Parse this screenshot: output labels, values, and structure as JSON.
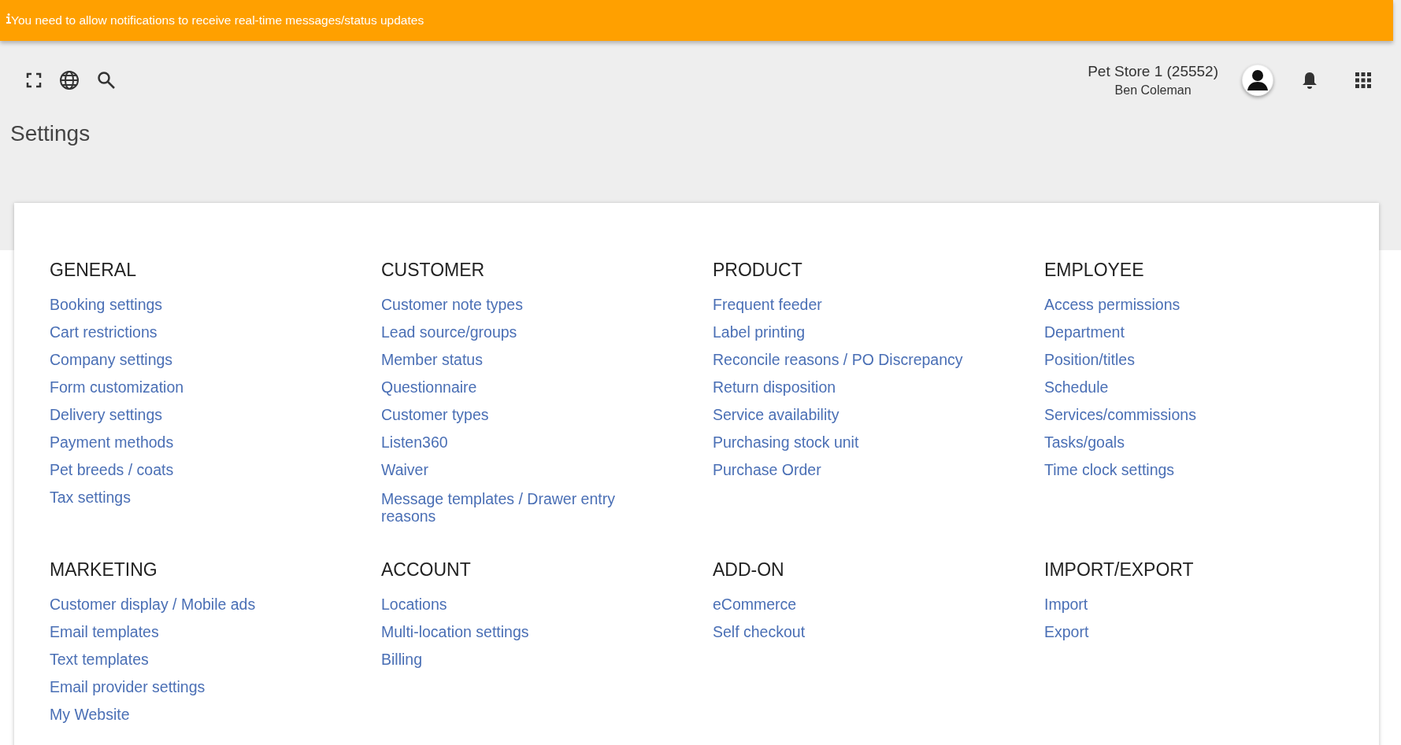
{
  "banner": {
    "text": "You need to allow notifications to receive real-time messages/status updates"
  },
  "header": {
    "store": "Pet Store 1 (25552)",
    "user": "Ben Coleman"
  },
  "page_title": "Settings",
  "sections": [
    {
      "title": "GENERAL",
      "links": [
        "Booking settings",
        "Cart restrictions",
        "Company settings",
        "Form customization",
        "Delivery settings",
        "Payment methods",
        "Pet breeds / coats",
        "Tax settings"
      ]
    },
    {
      "title": "CUSTOMER",
      "links": [
        "Customer note types",
        "Lead source/groups",
        "Member status",
        "Questionnaire",
        "Customer types",
        "Listen360",
        "Waiver",
        "Message templates / Drawer entry reasons"
      ]
    },
    {
      "title": "PRODUCT",
      "links": [
        "Frequent feeder",
        "Label printing",
        "Reconcile reasons / PO Discrepancy",
        "Return disposition",
        "Service availability",
        "Purchasing stock unit",
        "Purchase Order"
      ]
    },
    {
      "title": "EMPLOYEE",
      "links": [
        "Access permissions",
        "Department",
        "Position/titles",
        "Schedule",
        "Services/commissions",
        "Tasks/goals",
        "Time clock settings"
      ]
    },
    {
      "title": "MARKETING",
      "links": [
        "Customer display / Mobile ads",
        "Email templates",
        "Text templates",
        "Email provider settings",
        "My Website"
      ]
    },
    {
      "title": "ACCOUNT",
      "links": [
        "Locations",
        "Multi-location settings",
        "Billing"
      ]
    },
    {
      "title": "ADD-ON",
      "links": [
        "eCommerce",
        "Self checkout"
      ]
    },
    {
      "title": "IMPORT/EXPORT",
      "links": [
        "Import",
        "Export"
      ]
    }
  ]
}
